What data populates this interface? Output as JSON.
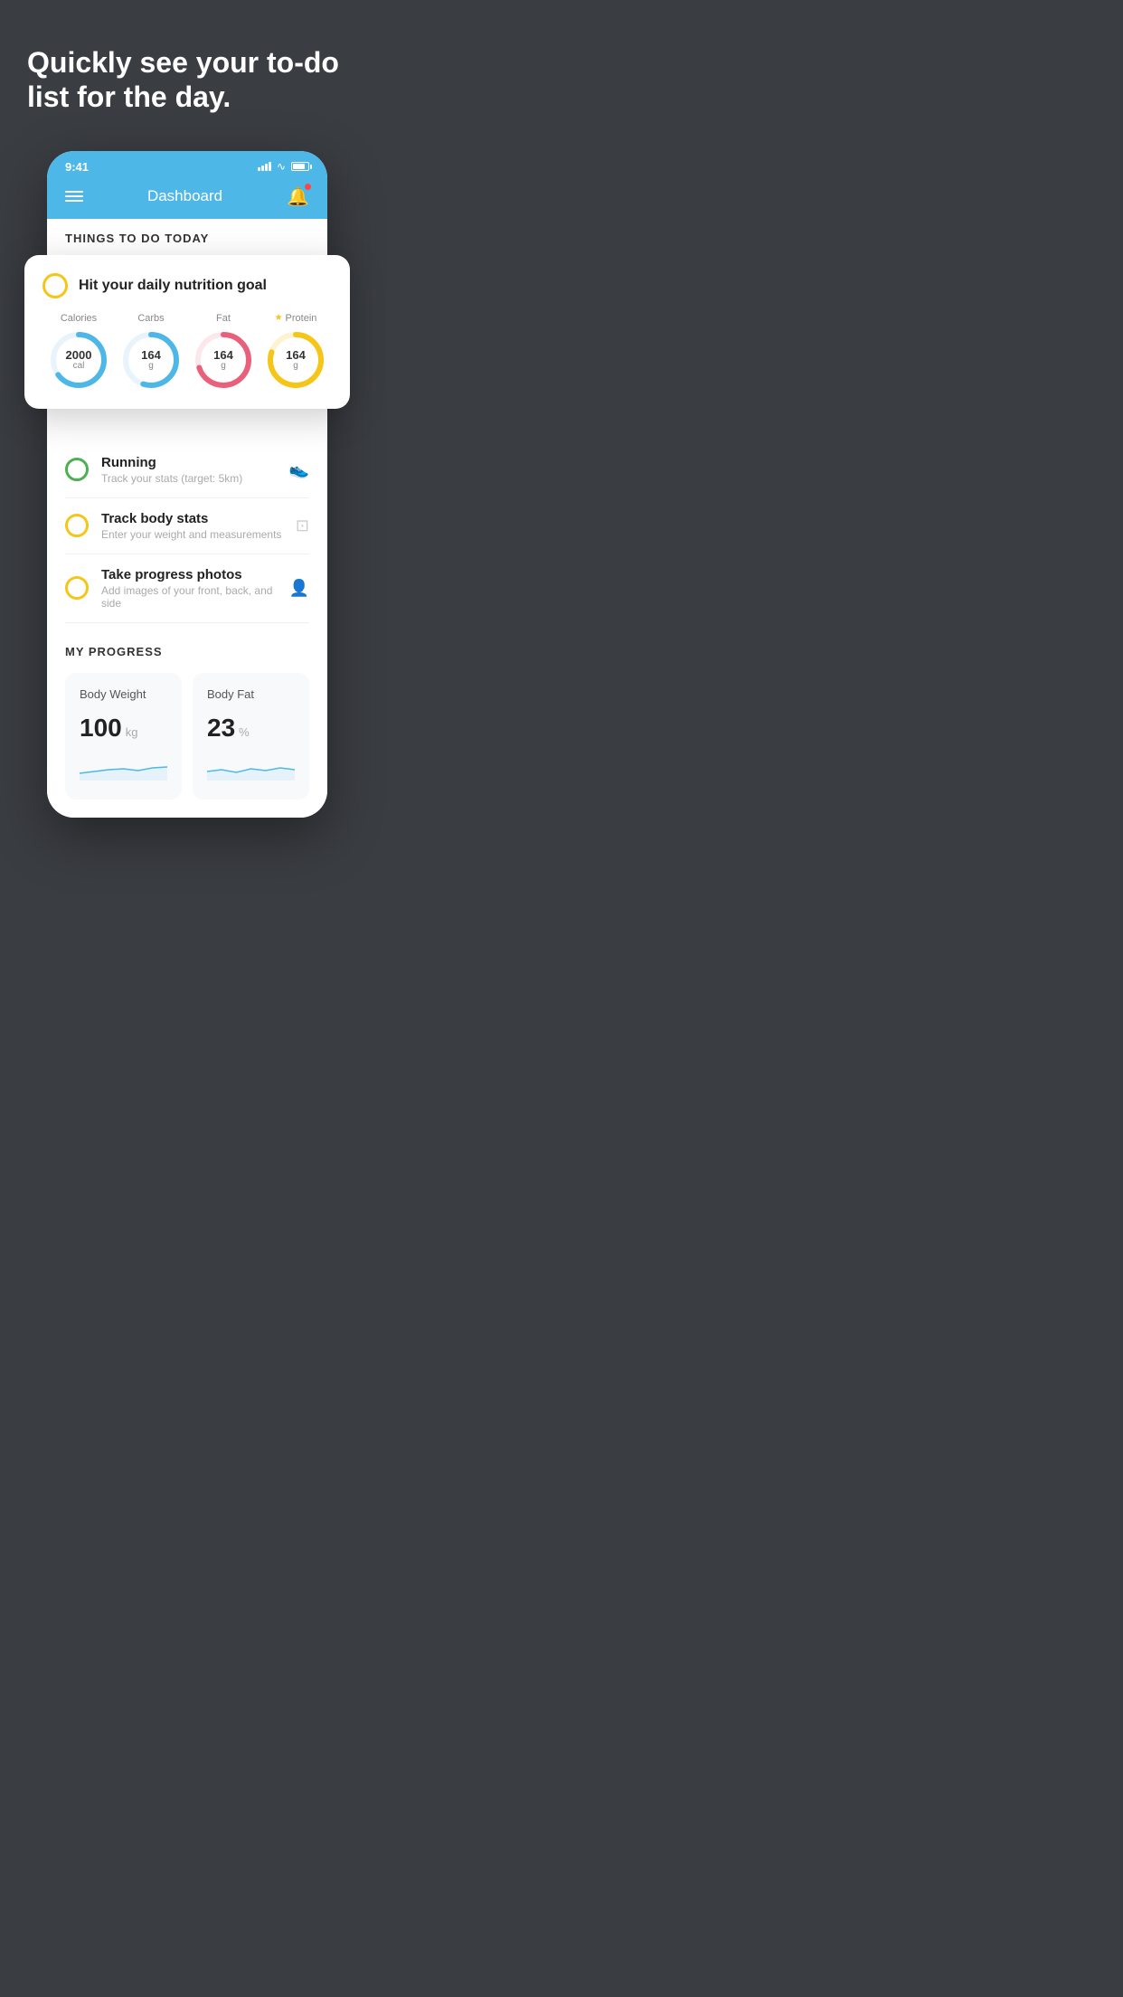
{
  "hero": {
    "title": "Quickly see your to-do list for the day."
  },
  "phone": {
    "status": {
      "time": "9:41"
    },
    "nav": {
      "title": "Dashboard"
    },
    "thingsToDo": {
      "sectionTitle": "THINGS TO DO TODAY"
    },
    "floatingCard": {
      "title": "Hit your daily nutrition goal",
      "rings": [
        {
          "label": "Calories",
          "value": "2000",
          "unit": "cal",
          "color": "#4db8e8",
          "percent": 65,
          "star": false
        },
        {
          "label": "Carbs",
          "value": "164",
          "unit": "g",
          "color": "#4db8e8",
          "percent": 55,
          "star": false
        },
        {
          "label": "Fat",
          "value": "164",
          "unit": "g",
          "color": "#e8607a",
          "percent": 70,
          "star": false
        },
        {
          "label": "Protein",
          "value": "164",
          "unit": "g",
          "color": "#f5c518",
          "percent": 80,
          "star": true
        }
      ]
    },
    "todoItems": [
      {
        "id": "running",
        "title": "Running",
        "subtitle": "Track your stats (target: 5km)",
        "circleColor": "green",
        "icon": "shoe"
      },
      {
        "id": "body-stats",
        "title": "Track body stats",
        "subtitle": "Enter your weight and measurements",
        "circleColor": "yellow",
        "icon": "scale"
      },
      {
        "id": "progress-photos",
        "title": "Take progress photos",
        "subtitle": "Add images of your front, back, and side",
        "circleColor": "yellow",
        "icon": "person"
      }
    ],
    "progress": {
      "sectionTitle": "MY PROGRESS",
      "cards": [
        {
          "title": "Body Weight",
          "value": "100",
          "unit": "kg"
        },
        {
          "title": "Body Fat",
          "value": "23",
          "unit": "%"
        }
      ]
    }
  }
}
